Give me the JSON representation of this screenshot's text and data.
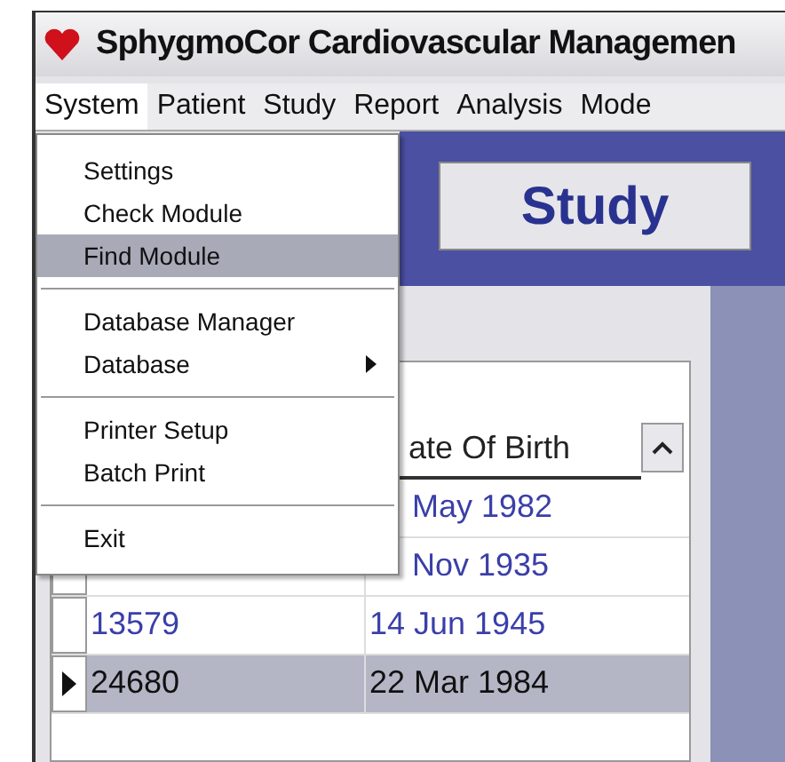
{
  "window": {
    "title": "SphygmoCor Cardiovascular Managemen"
  },
  "menu_bar": [
    {
      "label": "System",
      "selected": true
    },
    {
      "label": "Patient",
      "selected": false
    },
    {
      "label": "Study",
      "selected": false
    },
    {
      "label": "Report",
      "selected": false
    },
    {
      "label": "Analysis",
      "selected": false
    },
    {
      "label": "Mode",
      "selected": false
    }
  ],
  "menu": {
    "sections": [
      [
        {
          "label": "Settings",
          "selected": false,
          "submenu": false
        },
        {
          "label": "Check Module",
          "selected": false,
          "submenu": false
        },
        {
          "label": "Find Module",
          "selected": true,
          "submenu": false
        }
      ],
      [
        {
          "label": "Database Manager",
          "selected": false,
          "submenu": false
        },
        {
          "label": "Database",
          "selected": false,
          "submenu": true
        }
      ],
      [
        {
          "label": "Printer Setup",
          "selected": false,
          "submenu": false
        },
        {
          "label": "Batch Print",
          "selected": false,
          "submenu": false
        }
      ],
      [
        {
          "label": "Exit",
          "selected": false,
          "submenu": false
        }
      ]
    ]
  },
  "study_button": {
    "label": "Study"
  },
  "grid": {
    "column_2": "ate Of Birth",
    "rows": [
      {
        "date": "May 1982",
        "selected": false
      },
      {
        "date": "Nov 1935",
        "selected": false
      },
      {
        "id": "13579",
        "date": "14 Jun 1945",
        "selected": false
      },
      {
        "id": "24680",
        "date": "22 Mar 1984",
        "selected": true
      }
    ]
  }
}
